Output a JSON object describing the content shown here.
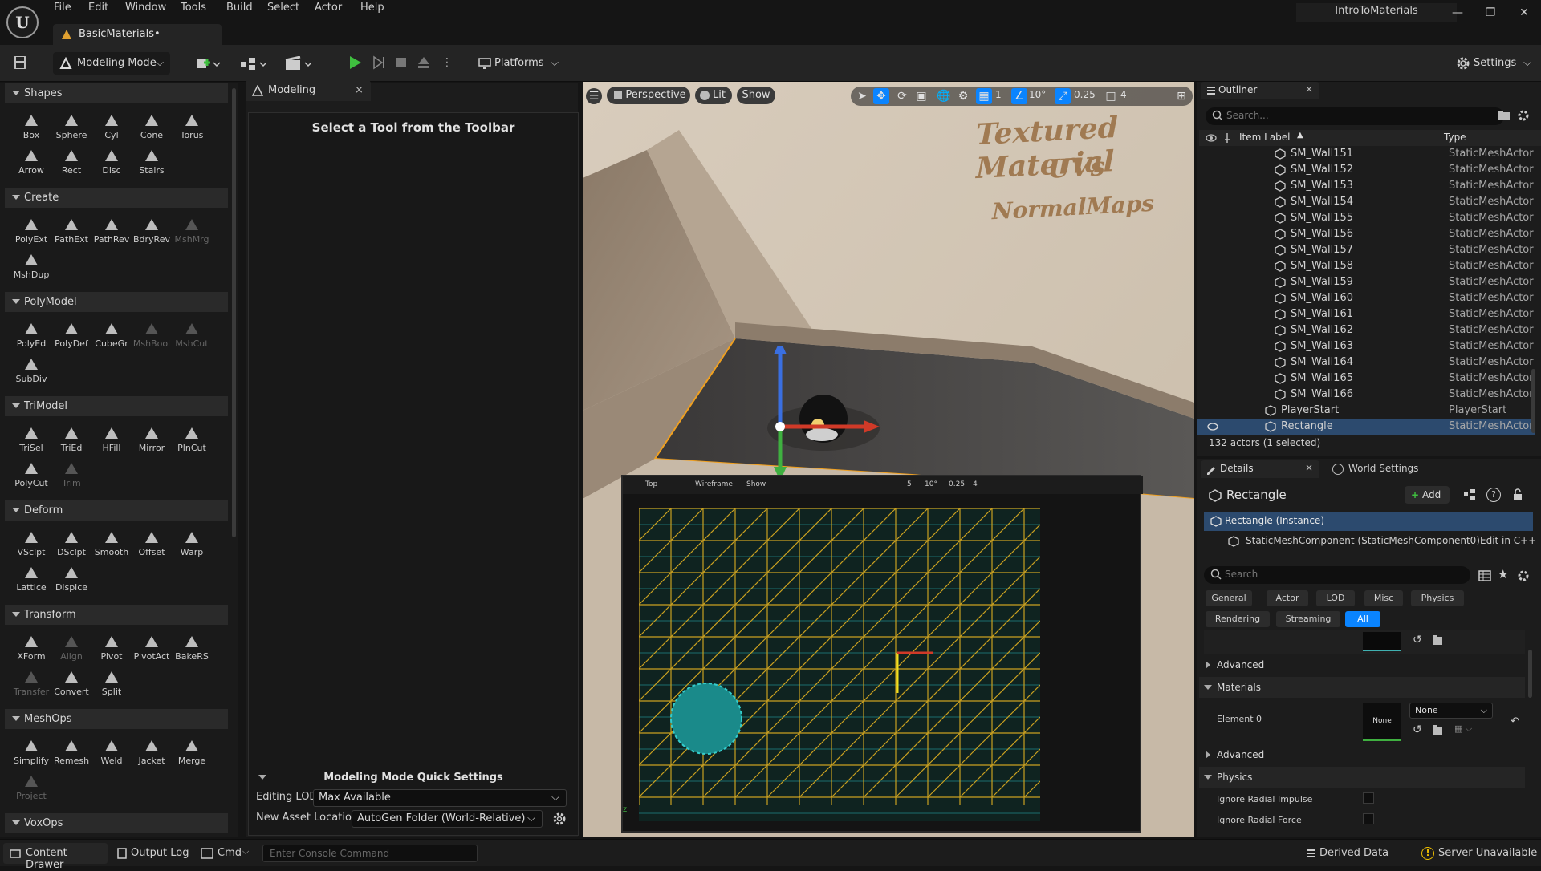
{
  "app": {
    "logo_text": "U",
    "menu": [
      "File",
      "Edit",
      "Window",
      "Tools",
      "Build",
      "Select",
      "Actor",
      "Help"
    ],
    "project_name": "IntroToMaterials",
    "document_tab": "BasicMaterials•"
  },
  "toolbar": {
    "mode_label": "Modeling Mode",
    "platforms_label": "Platforms",
    "settings_label": "Settings"
  },
  "shelf": {
    "categories": [
      {
        "name": "Shapes",
        "tools": [
          {
            "label": "Box",
            "enabled": true
          },
          {
            "label": "Sphere",
            "enabled": true
          },
          {
            "label": "Cyl",
            "enabled": true
          },
          {
            "label": "Cone",
            "enabled": true
          },
          {
            "label": "Torus",
            "enabled": true
          },
          {
            "label": "Arrow",
            "enabled": true
          },
          {
            "label": "Rect",
            "enabled": true
          },
          {
            "label": "Disc",
            "enabled": true
          },
          {
            "label": "Stairs",
            "enabled": true
          }
        ]
      },
      {
        "name": "Create",
        "tools": [
          {
            "label": "PolyExt",
            "enabled": true
          },
          {
            "label": "PathExt",
            "enabled": true
          },
          {
            "label": "PathRev",
            "enabled": true
          },
          {
            "label": "BdryRev",
            "enabled": true
          },
          {
            "label": "MshMrg",
            "enabled": false
          },
          {
            "label": "MshDup",
            "enabled": true
          }
        ]
      },
      {
        "name": "PolyModel",
        "tools": [
          {
            "label": "PolyEd",
            "enabled": true
          },
          {
            "label": "PolyDef",
            "enabled": true
          },
          {
            "label": "CubeGr",
            "enabled": true
          },
          {
            "label": "MshBool",
            "enabled": false
          },
          {
            "label": "MshCut",
            "enabled": false
          },
          {
            "label": "SubDiv",
            "enabled": true
          }
        ]
      },
      {
        "name": "TriModel",
        "tools": [
          {
            "label": "TriSel",
            "enabled": true
          },
          {
            "label": "TriEd",
            "enabled": true
          },
          {
            "label": "HFill",
            "enabled": true
          },
          {
            "label": "Mirror",
            "enabled": true
          },
          {
            "label": "PlnCut",
            "enabled": true
          },
          {
            "label": "PolyCut",
            "enabled": true
          },
          {
            "label": "Trim",
            "enabled": false
          }
        ]
      },
      {
        "name": "Deform",
        "tools": [
          {
            "label": "VSclpt",
            "enabled": true
          },
          {
            "label": "DSclpt",
            "enabled": true
          },
          {
            "label": "Smooth",
            "enabled": true
          },
          {
            "label": "Offset",
            "enabled": true
          },
          {
            "label": "Warp",
            "enabled": true
          },
          {
            "label": "Lattice",
            "enabled": true
          },
          {
            "label": "Displce",
            "enabled": true
          }
        ]
      },
      {
        "name": "Transform",
        "tools": [
          {
            "label": "XForm",
            "enabled": true
          },
          {
            "label": "Align",
            "enabled": false
          },
          {
            "label": "Pivot",
            "enabled": true
          },
          {
            "label": "PivotAct",
            "enabled": true
          },
          {
            "label": "BakeRS",
            "enabled": true
          },
          {
            "label": "Transfer",
            "enabled": false
          },
          {
            "label": "Convert",
            "enabled": true
          },
          {
            "label": "Split",
            "enabled": true
          }
        ]
      },
      {
        "name": "MeshOps",
        "tools": [
          {
            "label": "Simplify",
            "enabled": true
          },
          {
            "label": "Remesh",
            "enabled": true
          },
          {
            "label": "Weld",
            "enabled": true
          },
          {
            "label": "Jacket",
            "enabled": true
          },
          {
            "label": "Merge",
            "enabled": true
          },
          {
            "label": "Project",
            "enabled": false
          }
        ]
      },
      {
        "name": "VoxOps",
        "tools": []
      }
    ]
  },
  "modeling_panel": {
    "tab_label": "Modeling",
    "message": "Select a Tool from the Toolbar",
    "quick_settings_title": "Modeling Mode Quick Settings",
    "editing_lod_label": "Editing LOD",
    "editing_lod_value": "Max Available",
    "asset_location_label": "New Asset Location",
    "asset_location_value": "AutoGen Folder (World-Relative)"
  },
  "viewport": {
    "perspective_label": "Perspective",
    "lit_label": "Lit",
    "show_label": "Show",
    "rotation_snap": "10°",
    "scale_snap": "0.25",
    "grid_snap": "1",
    "camera_speed": "4",
    "wall_text": [
      "Textured Material",
      "UVs",
      "NormalMaps"
    ],
    "inset": {
      "view_label": "Top",
      "mode_label": "Wireframe",
      "show_label": "Show",
      "grid_snap": "5",
      "rotation_snap": "10°",
      "scale_snap": "0.25",
      "camera_speed": "4"
    }
  },
  "outliner": {
    "title": "Outliner",
    "search_placeholder": "Search...",
    "col_label": "Item Label",
    "col_type": "Type",
    "rows": [
      {
        "label": "SM_Wall151",
        "type": "StaticMeshActor"
      },
      {
        "label": "SM_Wall152",
        "type": "StaticMeshActor"
      },
      {
        "label": "SM_Wall153",
        "type": "StaticMeshActor"
      },
      {
        "label": "SM_Wall154",
        "type": "StaticMeshActor"
      },
      {
        "label": "SM_Wall155",
        "type": "StaticMeshActor"
      },
      {
        "label": "SM_Wall156",
        "type": "StaticMeshActor"
      },
      {
        "label": "SM_Wall157",
        "type": "StaticMeshActor"
      },
      {
        "label": "SM_Wall158",
        "type": "StaticMeshActor"
      },
      {
        "label": "SM_Wall159",
        "type": "StaticMeshActor"
      },
      {
        "label": "SM_Wall160",
        "type": "StaticMeshActor"
      },
      {
        "label": "SM_Wall161",
        "type": "StaticMeshActor"
      },
      {
        "label": "SM_Wall162",
        "type": "StaticMeshActor"
      },
      {
        "label": "SM_Wall163",
        "type": "StaticMeshActor"
      },
      {
        "label": "SM_Wall164",
        "type": "StaticMeshActor"
      },
      {
        "label": "SM_Wall165",
        "type": "StaticMeshActor"
      },
      {
        "label": "SM_Wall166",
        "type": "StaticMeshActor"
      },
      {
        "label": "PlayerStart",
        "type": "PlayerStart"
      },
      {
        "label": "Rectangle",
        "type": "StaticMeshActor"
      }
    ],
    "actor_count": "132 actors (1 selected)"
  },
  "details": {
    "tab_label": "Details",
    "world_settings_label": "World Settings",
    "actor_name": "Rectangle",
    "add_label": "Add",
    "instance_label": "Rectangle (Instance)",
    "component_label": "StaticMeshComponent (StaticMeshComponent0)",
    "edit_cpp_label": "Edit in C++",
    "search_placeholder": "Search",
    "filter_tabs": [
      "General",
      "Actor",
      "LOD",
      "Misc",
      "Physics",
      "Rendering",
      "Streaming",
      "All"
    ],
    "advanced_label": "Advanced",
    "materials_label": "Materials",
    "element0_label": "Element 0",
    "material_thumb_label": "None",
    "material_combo_value": "None",
    "advanced2_label": "Advanced",
    "physics_label": "Physics",
    "ignore_impulse_label": "Ignore Radial Impulse",
    "ignore_force_label": "Ignore Radial Force"
  },
  "statusbar": {
    "content_drawer": "Content Drawer",
    "output_log": "Output Log",
    "cmd": "Cmd",
    "console_placeholder": "Enter Console Command",
    "derived_data": "Derived Data",
    "server_status": "Server Unavailable"
  },
  "colors": {
    "accent": "#0a84ff",
    "selection_row": "#2c4a6e",
    "play_green": "#3fbf3f",
    "warning_yellow": "#f0c000",
    "wall_text": "#a07a52"
  }
}
